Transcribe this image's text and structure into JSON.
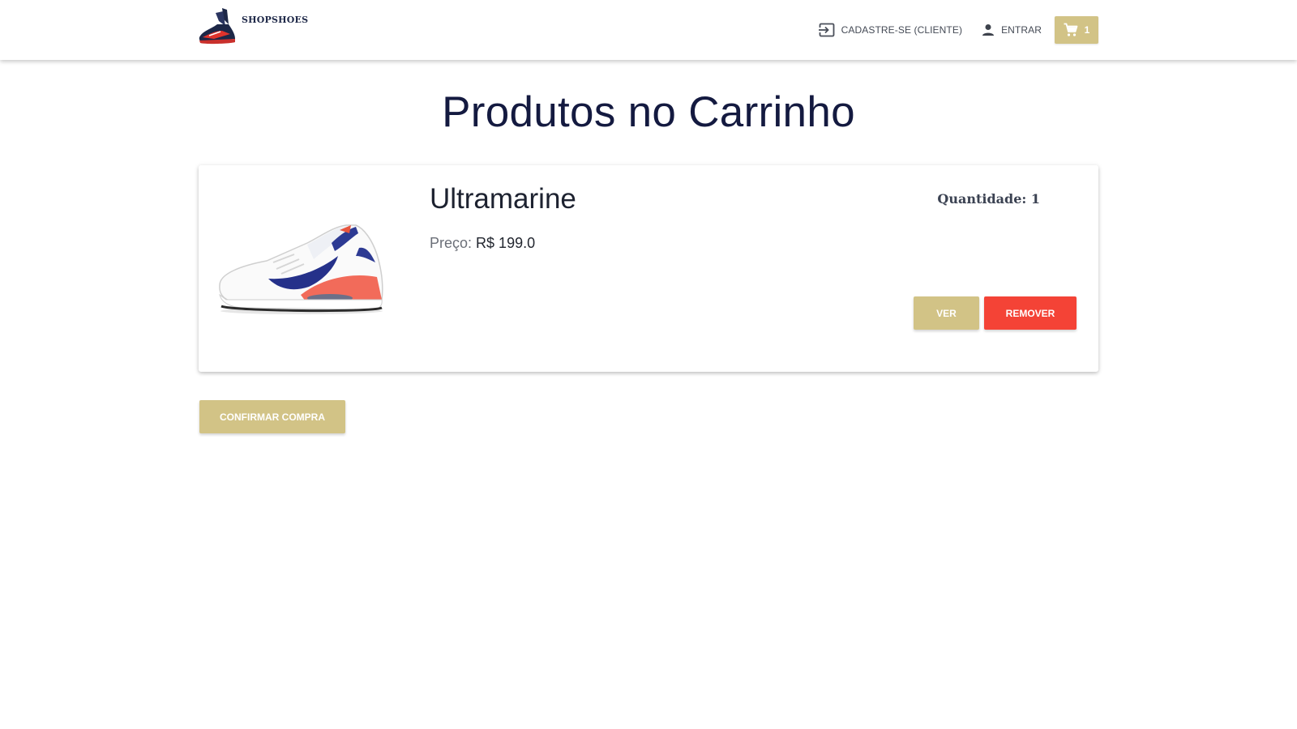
{
  "header": {
    "brand": "SHOPSHOES",
    "nav": {
      "register_label": "CADASTRE-SE (CLIENTE)",
      "login_label": "ENTRAR",
      "cart_count": "1"
    }
  },
  "page": {
    "title": "Produtos no Carrinho"
  },
  "cart": {
    "items": [
      {
        "name": "Ultramarine",
        "price_label": "Preço:",
        "price_value": "R$ 199.0",
        "quantity_text": "Quantidade: 1",
        "view_label": "VER",
        "remove_label": "REMOVER"
      }
    ],
    "confirm_label": "CONFIRMAR COMPRA"
  },
  "colors": {
    "accent": "#d2c386",
    "danger": "#f44336",
    "title": "#141a40"
  },
  "icons": {
    "register": "login-icon",
    "login": "person-icon",
    "cart": "shopping-cart-icon"
  }
}
